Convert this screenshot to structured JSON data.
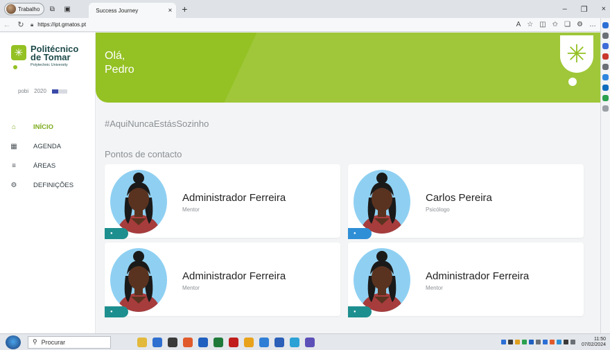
{
  "browser": {
    "profile_label": "Trabalho",
    "tab_title": "Success Journey",
    "url": "https://ipt.gmatos.pt"
  },
  "sidebar": {
    "logo": {
      "line1": "Politécnico",
      "line2": "de Tomar",
      "line3": "Polytechnic University"
    },
    "partners": {
      "p1": "pobi",
      "p2": "2020"
    },
    "items": [
      {
        "label": "INÍCIO",
        "icon": "home-icon",
        "active": true
      },
      {
        "label": "AGENDA",
        "icon": "calendar-icon",
        "active": false
      },
      {
        "label": "ÁREAS",
        "icon": "menu-icon",
        "active": false
      },
      {
        "label": "DEFINIÇÕES",
        "icon": "gear-icon",
        "active": false
      }
    ]
  },
  "banner": {
    "greeting": "Olá,",
    "name": "Pedro"
  },
  "hashtag": "#AquiNuncaEstásSozinho",
  "contacts_title": "Pontos de contacto",
  "contacts": [
    {
      "name": "Administrador Ferreira",
      "role": "Mentor"
    },
    {
      "name": "Carlos Pereira",
      "role": "Psicólogo"
    },
    {
      "name": "Administrador Ferreira",
      "role": "Mentor"
    },
    {
      "name": "Administrador Ferreira",
      "role": "Mentor"
    }
  ],
  "taskbar": {
    "search_placeholder": "Procurar",
    "time": "11:50",
    "date": "07/02/2024"
  },
  "colors": {
    "brand": "#94c123",
    "sidebar_text": "#2f3a40",
    "pill_teal": "#1e8f8f",
    "pill_blue": "#2f8fd6"
  }
}
